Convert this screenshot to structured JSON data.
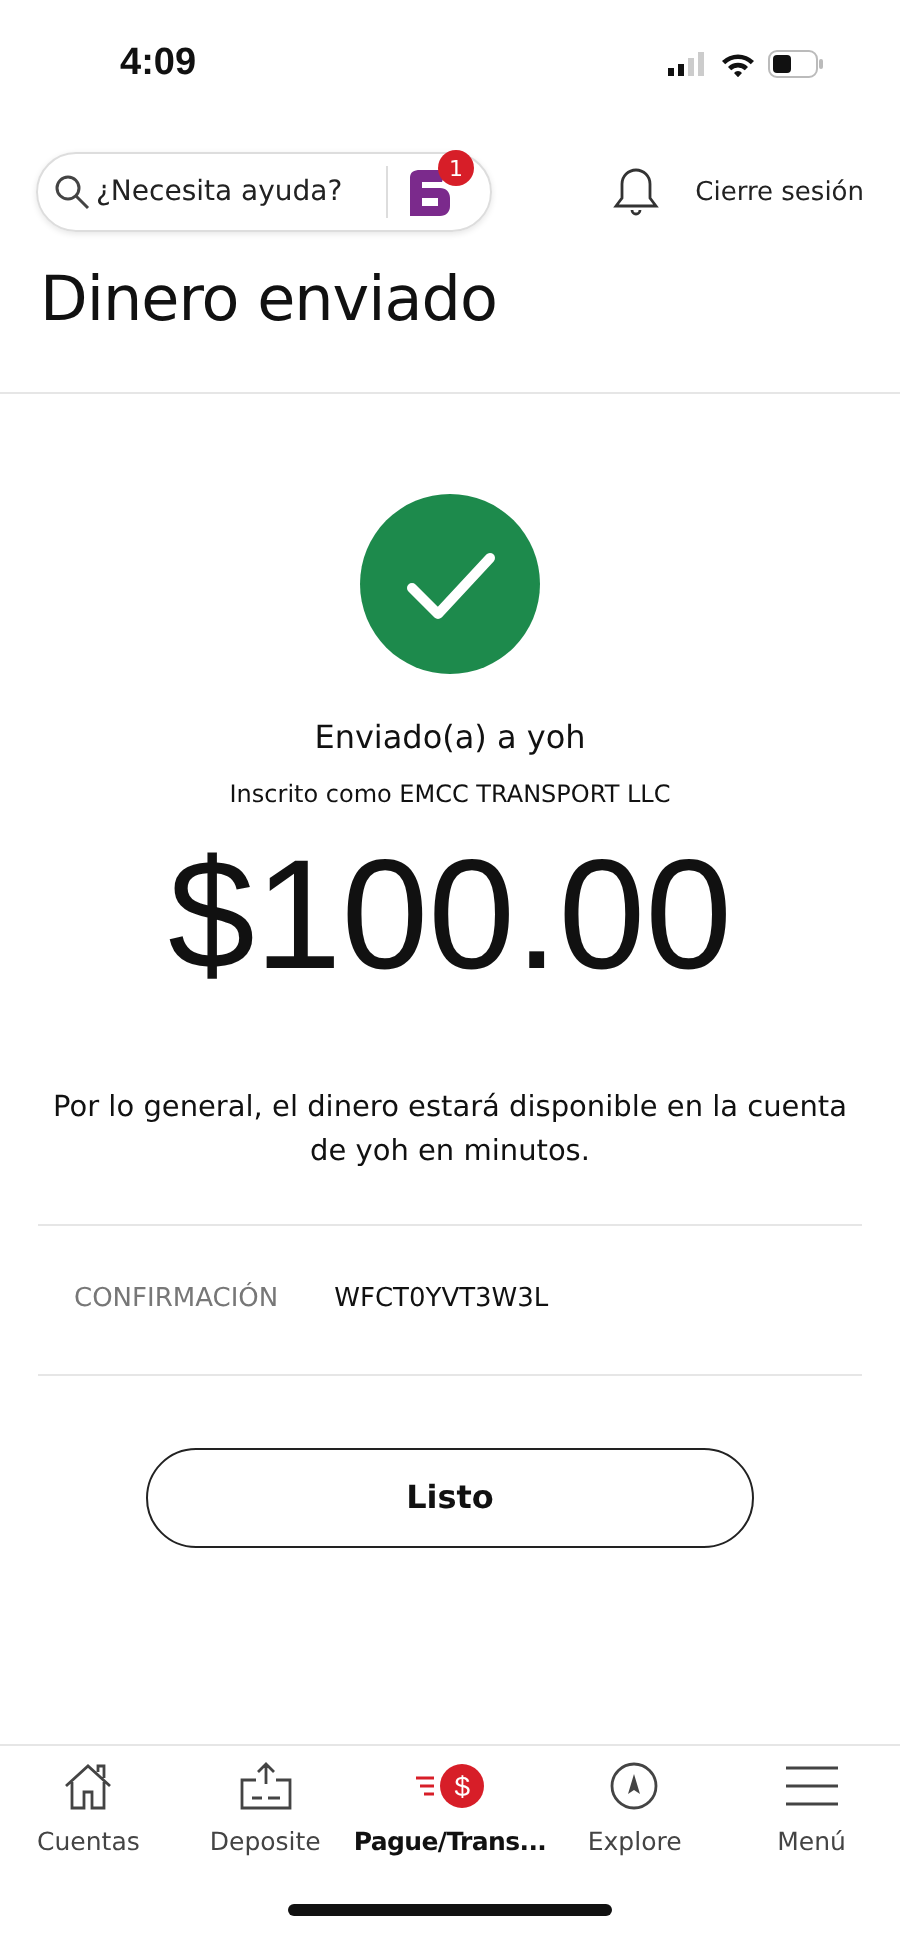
{
  "status_bar": {
    "time": "4:09"
  },
  "header": {
    "search": {
      "placeholder": "¿Necesita ayuda?"
    },
    "assistant_badge": "1",
    "logout": "Cierre sesión"
  },
  "title": "Dinero enviado",
  "confirmation": {
    "recipient": "Enviado(a) a yoh",
    "enrolled_as": "Inscrito como EMCC TRANSPORT LLC",
    "amount": "$100.00",
    "note": "Por lo general, el dinero estará disponible en la cuenta de yoh en minutos.",
    "label": "CONFIRMACIÓN",
    "code": "WFCT0YVT3W3L"
  },
  "done_button": "Listo",
  "bottom_nav": [
    {
      "kind": "home",
      "label": "Cuentas",
      "selected": false
    },
    {
      "kind": "deposit",
      "label": "Deposite",
      "selected": false
    },
    {
      "kind": "pay",
      "glyph": "$",
      "label": "Pague/Trans...",
      "selected": true
    },
    {
      "kind": "explore",
      "label": "Explore",
      "selected": false
    },
    {
      "kind": "menu",
      "label": "Menú",
      "selected": false
    }
  ]
}
